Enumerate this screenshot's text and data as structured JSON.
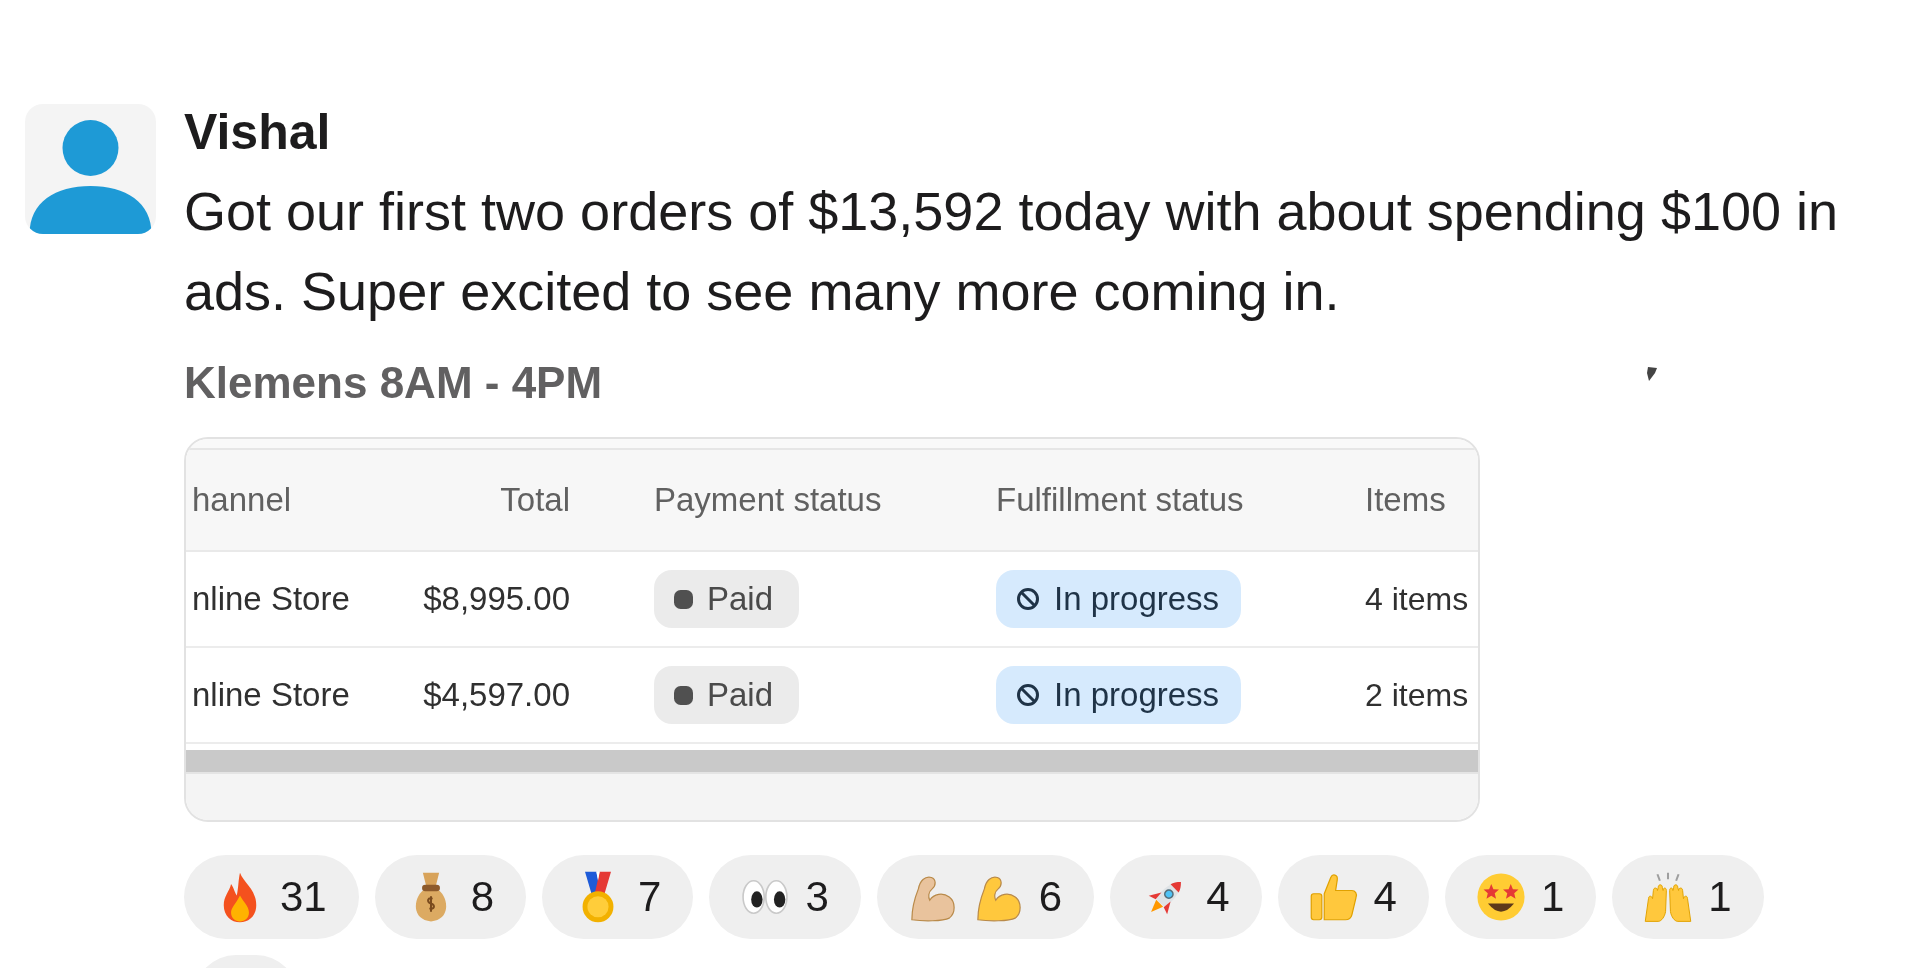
{
  "message": {
    "author": "Vishal",
    "text": "Got our first two orders of $13,592 today with about spending $100 in ads. Super excited to see many more coming in.",
    "caption": "Klemens 8AM - 4PM"
  },
  "attachment": {
    "table": {
      "columns": [
        "hannel",
        "Total",
        "Payment status",
        "Fulfillment status",
        "Items"
      ],
      "rows": [
        {
          "channel": "nline Store",
          "total": "$8,995.00",
          "payment_status": "Paid",
          "fulfillment_status": "In progress",
          "items": "4 items"
        },
        {
          "channel": "nline Store",
          "total": "$4,597.00",
          "payment_status": "Paid",
          "fulfillment_status": "In progress",
          "items": "2 items"
        }
      ]
    }
  },
  "reactions": [
    {
      "emojis": [
        {
          "kind": "fire"
        }
      ],
      "count": "31"
    },
    {
      "emojis": [
        {
          "kind": "moneybag"
        }
      ],
      "count": "8"
    },
    {
      "emojis": [
        {
          "kind": "medal"
        }
      ],
      "count": "7"
    },
    {
      "emojis": [
        {
          "kind": "eyes"
        }
      ],
      "count": "3"
    },
    {
      "emojis": [
        {
          "kind": "bicepslight"
        },
        {
          "kind": "biceps"
        }
      ],
      "count": "6"
    },
    {
      "emojis": [
        {
          "kind": "rocket"
        }
      ],
      "count": "4"
    },
    {
      "emojis": [
        {
          "kind": "thumbsup"
        }
      ],
      "count": "4"
    },
    {
      "emojis": [
        {
          "kind": "starstruck"
        }
      ],
      "count": "1"
    },
    {
      "emojis": [
        {
          "kind": "raisedhands"
        }
      ],
      "count": "1"
    }
  ]
}
